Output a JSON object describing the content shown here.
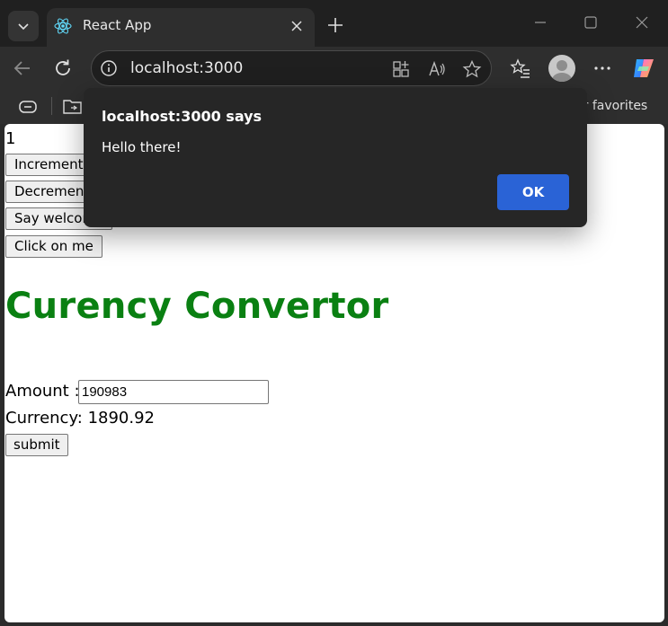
{
  "browser": {
    "tab_title": "React App",
    "url": "localhost:3000",
    "favorites_partial": "er favorites"
  },
  "icons": {
    "tab_list": "chevron-down-icon",
    "favicon": "react-logo-icon",
    "tab_close": "close-icon",
    "new_tab": "plus-icon",
    "minimize": "minimize-icon",
    "maximize": "maximize-icon",
    "close_window": "close-icon",
    "back": "back-arrow-icon",
    "refresh": "refresh-icon",
    "site_info": "info-icon",
    "app_available": "app-grid-icon",
    "read_aloud": "read-aloud-icon",
    "favorite": "star-icon",
    "favorites": "favorites-list-icon",
    "profile": "profile-avatar-icon",
    "more": "ellipsis-icon",
    "copilot": "copilot-icon",
    "fav_bar_1": "link-icon",
    "fav_bar_2": "folder-icon"
  },
  "page": {
    "count": "1",
    "buttons": {
      "increment": "Increment",
      "decrement": "Decrement",
      "say_welcome": "Say welcome",
      "click_on_me": "Click on me"
    },
    "heading": "Curency Convertor",
    "amount_label": "Amount :",
    "amount_value": "190983",
    "currency_text": "Currency: 1890.92",
    "submit_label": "submit"
  },
  "dialog": {
    "title": "localhost:3000 says",
    "message": "Hello there!",
    "ok_label": "OK"
  },
  "colors": {
    "heading_green": "#0a8012",
    "dialog_bg": "#262626",
    "ok_button": "#2a63d6"
  }
}
